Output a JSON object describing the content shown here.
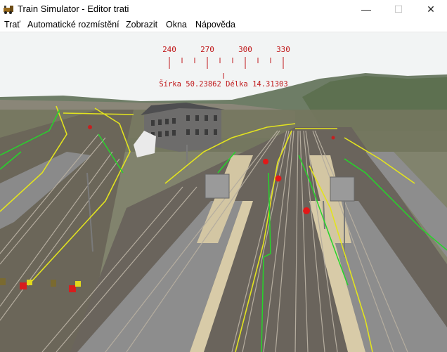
{
  "window": {
    "title": "Train Simulator - Editor trati",
    "icon": "locomotive-icon",
    "controls": {
      "minimize": "—",
      "maximize": "☐",
      "close": "✕"
    }
  },
  "menu": {
    "items": [
      "Trať",
      "Automatické rozmístění",
      "Zobrazit",
      "Okna",
      "Nápověda"
    ]
  },
  "compass": {
    "ticks": [
      "240",
      "270",
      "300",
      "330"
    ]
  },
  "coordinates": {
    "text": "Šírka 50.23862 Délka 14.31303"
  },
  "colors": {
    "sky": "#f2f4f4",
    "hills": "#6c7d62",
    "ground": "#74775e",
    "platform": "#8d8d8d",
    "platform_edge": "#d9cba8",
    "ballast": "#6c665e",
    "rail": "#b3aca1",
    "wire_yellow": "#e3e21c",
    "wire_green": "#25d62a",
    "signal_red": "#e01515",
    "compass_red": "#c0191b"
  }
}
